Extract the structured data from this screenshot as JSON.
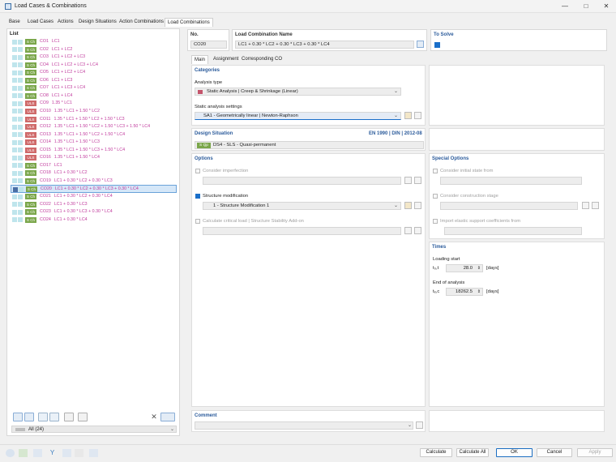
{
  "window": {
    "title": "Load Cases & Combinations"
  },
  "tabs": [
    "Base",
    "Load Cases",
    "Actions",
    "Design Situations",
    "Action Combinations",
    "Load Combinations"
  ],
  "list": {
    "title": "List",
    "rows": [
      {
        "badge": "S Ch",
        "co": "CO1",
        "formula": "LC1"
      },
      {
        "badge": "S Ch",
        "co": "CO2",
        "formula": "LC1 + LC2"
      },
      {
        "badge": "S Ch",
        "co": "CO3",
        "formula": "LC1 + LC2 + LC3"
      },
      {
        "badge": "S Ch",
        "co": "CO4",
        "formula": "LC1 + LC2 + LC3 + LC4"
      },
      {
        "badge": "S Ch",
        "co": "CO5",
        "formula": "LC1 + LC2 + LC4"
      },
      {
        "badge": "S Ch",
        "co": "CO6",
        "formula": "LC1 + LC3"
      },
      {
        "badge": "S Ch",
        "co": "CO7",
        "formula": "LC1 + LC3 + LC4"
      },
      {
        "badge": "S Ch",
        "co": "CO8",
        "formula": "LC1 + LC4"
      },
      {
        "badge": "ULS",
        "co": "CO9",
        "formula": "1.35 * LC1"
      },
      {
        "badge": "ULS",
        "co": "CO10",
        "formula": "1.35 * LC1 + 1.50 * LC2"
      },
      {
        "badge": "ULS",
        "co": "CO11",
        "formula": "1.35 * LC1 + 1.50 * LC2 + 1.50 * LC3"
      },
      {
        "badge": "ULS",
        "co": "CO12",
        "formula": "1.35 * LC1 + 1.50 * LC2 + 1.50 * LC3 + 1.50 * LC4"
      },
      {
        "badge": "ULS",
        "co": "CO13",
        "formula": "1.35 * LC1 + 1.50 * LC2 + 1.50 * LC4"
      },
      {
        "badge": "ULS",
        "co": "CO14",
        "formula": "1.35 * LC1 + 1.50 * LC3"
      },
      {
        "badge": "ULS",
        "co": "CO15",
        "formula": "1.35 * LC1 + 1.50 * LC3 + 1.50 * LC4"
      },
      {
        "badge": "ULS",
        "co": "CO16",
        "formula": "1.35 * LC1 + 1.50 * LC4"
      },
      {
        "badge": "S Ch",
        "co": "CO17",
        "formula": "LC1"
      },
      {
        "badge": "S Ch",
        "co": "CO18",
        "formula": "LC1 + 0.30 * LC2"
      },
      {
        "badge": "S Ch",
        "co": "CO19",
        "formula": "LC1 + 0.30 * LC2 + 0.30 * LC3"
      },
      {
        "badge": "S Ch",
        "co": "CO20",
        "formula": "LC1 + 0.30 * LC2 + 0.30 * LC3 + 0.30 * LC4",
        "selected": true
      },
      {
        "badge": "S Ch",
        "co": "CO21",
        "formula": "LC1 + 0.30 * LC2 + 0.30 * LC4"
      },
      {
        "badge": "S Ch",
        "co": "CO22",
        "formula": "LC1 + 0.30 * LC3"
      },
      {
        "badge": "S Ch",
        "co": "CO23",
        "formula": "LC1 + 0.30 * LC3 + 0.30 * LC4"
      },
      {
        "badge": "S Ch",
        "co": "CO24",
        "formula": "LC1 + 0.30 * LC4"
      }
    ],
    "filter_value": "All (24)"
  },
  "header": {
    "no_label": "No.",
    "no_value": "CO20",
    "name_label": "Load Combination Name",
    "name_value": "LC1 + 0.30 * LC2 + 0.30 * LC3 + 0.30 * LC4",
    "to_solve_label": "To Solve"
  },
  "subtabs": [
    "Main",
    "Assignment",
    "Corresponding CO"
  ],
  "categories": {
    "title": "Categories",
    "analysis_type_label": "Analysis type",
    "analysis_type_value": "Static Analysis | Creep & Shrinkage (Linear)",
    "settings_label": "Static analysis settings",
    "settings_value": "SA1 - Geometrically linear | Newton-Raphson"
  },
  "design_situation": {
    "title": "Design Situation",
    "standard": "EN 1990 | DIN | 2012-08",
    "badge": "S Qp",
    "value": "DS4 - SLS - Quasi-permanent"
  },
  "options": {
    "title": "Options",
    "imperfection": "Consider imperfection",
    "structure_mod": "Structure modification",
    "structure_mod_value": "1 - Structure Modification 1",
    "critical_load": "Calculate critical load | Structure Stability Add-on"
  },
  "special": {
    "title": "Special Options",
    "initial_state": "Consider initial state from",
    "construction_stage": "Consider construction stage",
    "elastic_support": "Import elastic support coefficients from"
  },
  "times": {
    "title": "Times",
    "loading_label": "Loading start",
    "loading_sym": "t₀,t",
    "loading_value": "28.0",
    "unit": "[days]",
    "end_label": "End of analysis",
    "end_sym": "tₑ,c",
    "end_value": "18262.5"
  },
  "comment": {
    "title": "Comment"
  },
  "buttons": {
    "calculate": "Calculate",
    "calculate_all": "Calculate All",
    "ok": "OK",
    "cancel": "Cancel",
    "apply": "Apply"
  },
  "colors": {
    "sch": "#7aa64a",
    "uls": "#cf6a6a",
    "formula": "#c0399c",
    "accent": "#1a6fc9"
  }
}
